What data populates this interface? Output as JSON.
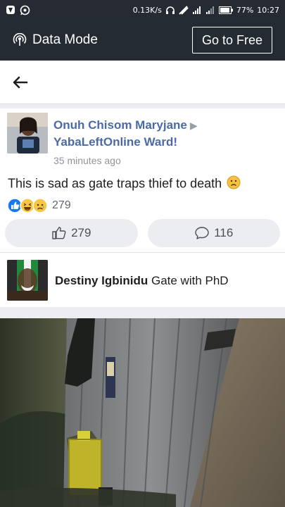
{
  "status_bar": {
    "net_speed": "0.13K/s",
    "battery": "77%",
    "time": "10:27",
    "icons": [
      "vpn-icon",
      "whatsapp-icon",
      "headset-icon",
      "data-saver-icon",
      "signal-icon",
      "wifi-signal-icon",
      "battery-icon"
    ]
  },
  "data_bar": {
    "data_mode_label": "Data Mode",
    "go_free_label": "Go to Free"
  },
  "nav": {
    "back_icon": "back-arrow-icon"
  },
  "post": {
    "author": "Onuh Chisom Maryjane",
    "group": "YabaLeftOnline Ward!",
    "time": "35 minutes ago",
    "text": "This is sad as gate traps thief to death",
    "text_emoji": "sad-face-emoji",
    "reactions": [
      "like",
      "haha",
      "sad"
    ],
    "reaction_count": "279",
    "like_count": "279",
    "comment_count": "116"
  },
  "comment": {
    "author": "Destiny Igbinidu",
    "text": "Gate with PhD"
  },
  "colors": {
    "topbar": "#252b33",
    "link_blue": "#4b6aa8",
    "pill_bg": "#ebedf0",
    "divider": "#eceef1"
  }
}
